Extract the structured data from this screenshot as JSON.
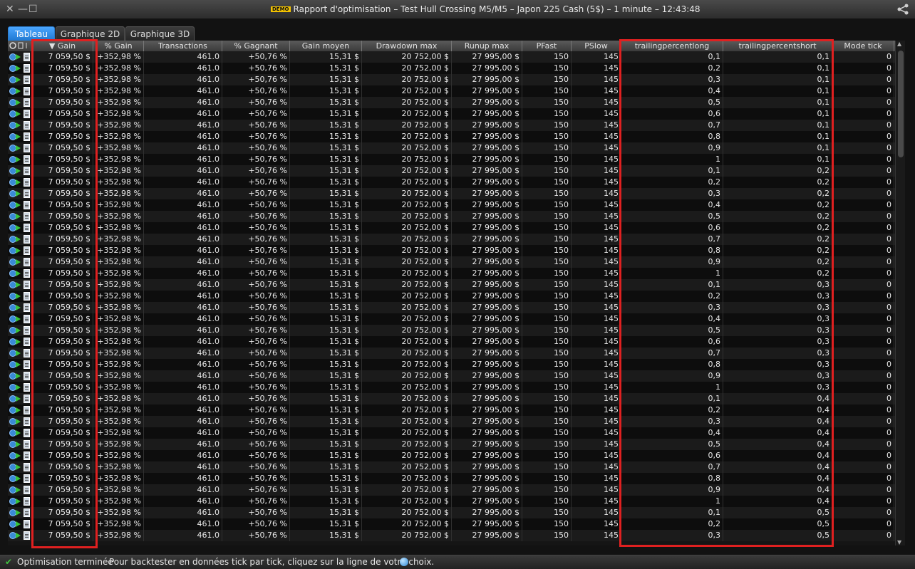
{
  "window": {
    "title": "Rapport d'optimisation – Test Hull Crossing M5/M5 – Japon 225 Cash (5$) – 1 minute – 12:43:48",
    "demo_badge": "DEMO",
    "close_glyph": "✕",
    "minimize_glyph": "—",
    "maximize_glyph": "☐"
  },
  "tabs": [
    {
      "label": "Tableau",
      "active": true
    },
    {
      "label": "Graphique 2D",
      "active": false
    },
    {
      "label": "Graphique 3D",
      "active": false
    }
  ],
  "columns": [
    "▼ Gain",
    "% Gain",
    "Transactions",
    "% Gagnant",
    "Gain moyen",
    "Drawdown max",
    "Runup max",
    "PFast",
    "PSlow",
    "trailingpercentlong",
    "trailingpercentshort",
    "Mode tick"
  ],
  "row_constant": {
    "gain": "7 059,50 $",
    "pct_gain": "+352,98 %",
    "transactions": "461.0",
    "pct_winning": "+50,76 %",
    "avg_gain": "15,31 $",
    "drawdown": "20 752,00 $",
    "runup": "27 995,00 $",
    "pfast": "150",
    "pslow": "145",
    "mode_tick": "0"
  },
  "rows": [
    {
      "tl": "0,1",
      "ts": "0,1"
    },
    {
      "tl": "0,2",
      "ts": "0,1"
    },
    {
      "tl": "0,3",
      "ts": "0,1"
    },
    {
      "tl": "0,4",
      "ts": "0,1"
    },
    {
      "tl": "0,5",
      "ts": "0,1"
    },
    {
      "tl": "0,6",
      "ts": "0,1"
    },
    {
      "tl": "0,7",
      "ts": "0,1"
    },
    {
      "tl": "0,8",
      "ts": "0,1"
    },
    {
      "tl": "0,9",
      "ts": "0,1"
    },
    {
      "tl": "1",
      "ts": "0,1"
    },
    {
      "tl": "0,1",
      "ts": "0,2"
    },
    {
      "tl": "0,2",
      "ts": "0,2"
    },
    {
      "tl": "0,3",
      "ts": "0,2"
    },
    {
      "tl": "0,4",
      "ts": "0,2"
    },
    {
      "tl": "0,5",
      "ts": "0,2"
    },
    {
      "tl": "0,6",
      "ts": "0,2"
    },
    {
      "tl": "0,7",
      "ts": "0,2"
    },
    {
      "tl": "0,8",
      "ts": "0,2"
    },
    {
      "tl": "0,9",
      "ts": "0,2"
    },
    {
      "tl": "1",
      "ts": "0,2"
    },
    {
      "tl": "0,1",
      "ts": "0,3"
    },
    {
      "tl": "0,2",
      "ts": "0,3"
    },
    {
      "tl": "0,3",
      "ts": "0,3"
    },
    {
      "tl": "0,4",
      "ts": "0,3"
    },
    {
      "tl": "0,5",
      "ts": "0,3"
    },
    {
      "tl": "0,6",
      "ts": "0,3"
    },
    {
      "tl": "0,7",
      "ts": "0,3"
    },
    {
      "tl": "0,8",
      "ts": "0,3"
    },
    {
      "tl": "0,9",
      "ts": "0,3"
    },
    {
      "tl": "1",
      "ts": "0,3"
    },
    {
      "tl": "0,1",
      "ts": "0,4"
    },
    {
      "tl": "0,2",
      "ts": "0,4"
    },
    {
      "tl": "0,3",
      "ts": "0,4"
    },
    {
      "tl": "0,4",
      "ts": "0,4"
    },
    {
      "tl": "0,5",
      "ts": "0,4"
    },
    {
      "tl": "0,6",
      "ts": "0,4"
    },
    {
      "tl": "0,7",
      "ts": "0,4"
    },
    {
      "tl": "0,8",
      "ts": "0,4"
    },
    {
      "tl": "0,9",
      "ts": "0,4"
    },
    {
      "tl": "1",
      "ts": "0,4"
    },
    {
      "tl": "0,1",
      "ts": "0,5"
    },
    {
      "tl": "0,2",
      "ts": "0,5"
    },
    {
      "tl": "0,3",
      "ts": "0,5"
    }
  ],
  "status": {
    "message": "Optimisation terminée",
    "hint": "Pour backtester en données tick par tick, cliquez sur la ligne de votre choix."
  },
  "colors": {
    "highlight": "#e02020",
    "tab_active": "#1f78d1"
  }
}
